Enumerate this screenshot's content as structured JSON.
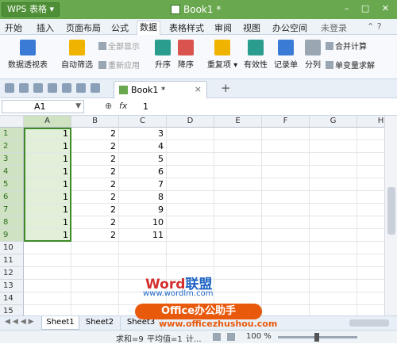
{
  "titlebar": {
    "app": "WPS 表格 ▾",
    "doc_title": "Book1 *",
    "window_buttons": "– □ ✕"
  },
  "menu": {
    "items": [
      "开始",
      "插入",
      "页面布局",
      "公式",
      "数据",
      "表格样式",
      "审阅",
      "视图",
      "办公空间"
    ],
    "active": "数据",
    "login": "未登录",
    "icons": "⌃ ?"
  },
  "ribbon": {
    "pivot": "数据透视表",
    "autofilter": "自动筛选",
    "show_all": "全部显示",
    "reapply": "重新应用",
    "sort_asc": "升序",
    "sort_desc": "降序",
    "duplicates": "重复项 ▾",
    "validity": "有效性",
    "record_sheet": "记录单",
    "split_column": "分列",
    "consolidate": "合并计算",
    "solver": "单变量求解"
  },
  "tabs": {
    "doc_tab": "Book1 *",
    "close": "×",
    "add": "+"
  },
  "formula": {
    "name_box": "A1",
    "fx": "fx",
    "value": "1"
  },
  "sheet": {
    "columns": [
      "A",
      "B",
      "C",
      "D",
      "E",
      "F",
      "G",
      "H"
    ],
    "rows": [
      "1",
      "2",
      "3",
      "4",
      "5",
      "6",
      "7",
      "8",
      "9",
      "10",
      "11",
      "12",
      "13",
      "14",
      "15"
    ],
    "colA": [
      "1",
      "1",
      "1",
      "1",
      "1",
      "1",
      "1",
      "1",
      "1"
    ],
    "colB": [
      "2",
      "2",
      "2",
      "2",
      "2",
      "2",
      "2",
      "2",
      "2"
    ],
    "colC": [
      "3",
      "4",
      "5",
      "6",
      "7",
      "8",
      "9",
      "10",
      "11"
    ]
  },
  "watermark": {
    "brand_a": "Word",
    "brand_b": "联盟",
    "url": "www.wordlm.com"
  },
  "sheet_tabs": [
    "Sheet1",
    "Sheet2",
    "Sheet3"
  ],
  "active_sheet": "Sheet1",
  "banner": {
    "title": "Office办公助手",
    "url": "www.officezhushou.com"
  },
  "status": {
    "sum": "求和=9",
    "avg": "平均值=1",
    "count": "计...",
    "zoom": "100 %"
  },
  "colors": {
    "accent": "#6aa84f",
    "selection": "#3d8b27",
    "banner": "#e8590c"
  }
}
